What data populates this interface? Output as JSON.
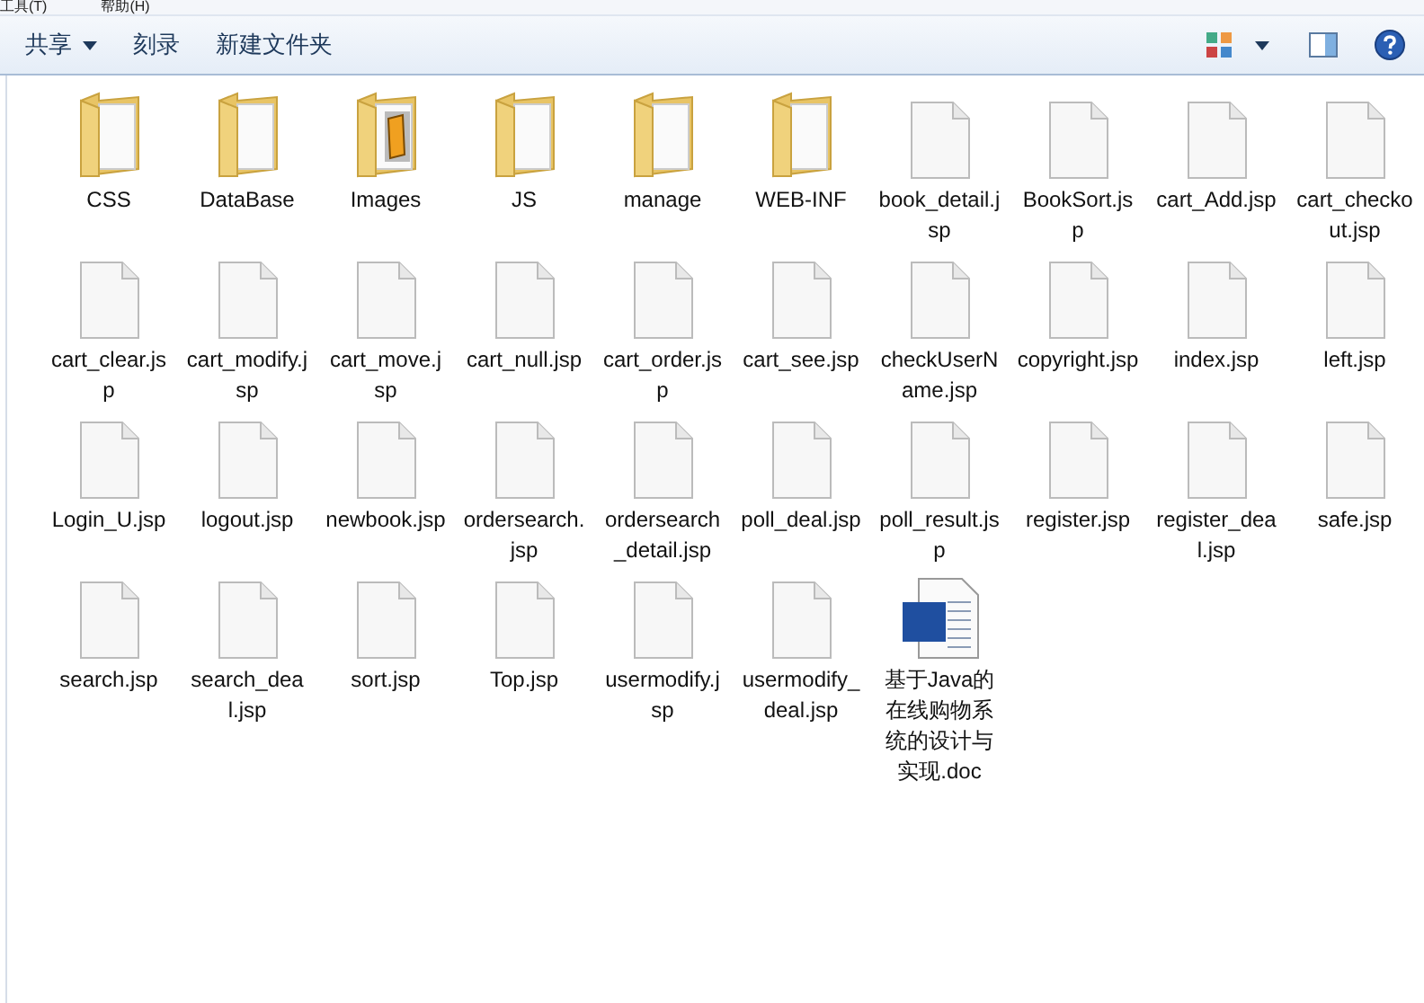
{
  "menu_bar": {
    "items": [
      "工具(T)",
      "帮助(H)"
    ]
  },
  "toolbar": {
    "buttons": [
      {
        "label": "共享",
        "dropdown": true
      },
      {
        "label": "刻录",
        "dropdown": false
      },
      {
        "label": "新建文件夹",
        "dropdown": false
      }
    ]
  },
  "files": [
    {
      "name": "CSS",
      "kind": "folder"
    },
    {
      "name": "DataBase",
      "kind": "folder"
    },
    {
      "name": "Images",
      "kind": "image-folder"
    },
    {
      "name": "JS",
      "kind": "folder"
    },
    {
      "name": "manage",
      "kind": "folder"
    },
    {
      "name": "WEB-INF",
      "kind": "folder"
    },
    {
      "name": "book_detail.jsp",
      "kind": "file"
    },
    {
      "name": "BookSort.jsp",
      "kind": "file"
    },
    {
      "name": "cart_Add.jsp",
      "kind": "file"
    },
    {
      "name": "cart_checkout.jsp",
      "kind": "file"
    },
    {
      "name": "cart_clear.jsp",
      "kind": "file"
    },
    {
      "name": "cart_modify.jsp",
      "kind": "file"
    },
    {
      "name": "cart_move.jsp",
      "kind": "file"
    },
    {
      "name": "cart_null.jsp",
      "kind": "file"
    },
    {
      "name": "cart_order.jsp",
      "kind": "file"
    },
    {
      "name": "cart_see.jsp",
      "kind": "file"
    },
    {
      "name": "checkUserName.jsp",
      "kind": "file"
    },
    {
      "name": "copyright.jsp",
      "kind": "file"
    },
    {
      "name": "index.jsp",
      "kind": "file"
    },
    {
      "name": "left.jsp",
      "kind": "file"
    },
    {
      "name": "Login_U.jsp",
      "kind": "file"
    },
    {
      "name": "logout.jsp",
      "kind": "file"
    },
    {
      "name": "newbook.jsp",
      "kind": "file"
    },
    {
      "name": "ordersearch.jsp",
      "kind": "file"
    },
    {
      "name": "ordersearch_detail.jsp",
      "kind": "file"
    },
    {
      "name": "poll_deal.jsp",
      "kind": "file"
    },
    {
      "name": "poll_result.jsp",
      "kind": "file"
    },
    {
      "name": "register.jsp",
      "kind": "file"
    },
    {
      "name": "register_deal.jsp",
      "kind": "file"
    },
    {
      "name": "safe.jsp",
      "kind": "file"
    },
    {
      "name": "search.jsp",
      "kind": "file"
    },
    {
      "name": "search_deal.jsp",
      "kind": "file"
    },
    {
      "name": "sort.jsp",
      "kind": "file"
    },
    {
      "name": "Top.jsp",
      "kind": "file"
    },
    {
      "name": "usermodify.jsp",
      "kind": "file"
    },
    {
      "name": "usermodify_deal.jsp",
      "kind": "file"
    },
    {
      "name": "基于Java的在线购物系统的设计与实现.doc",
      "kind": "doc"
    }
  ]
}
